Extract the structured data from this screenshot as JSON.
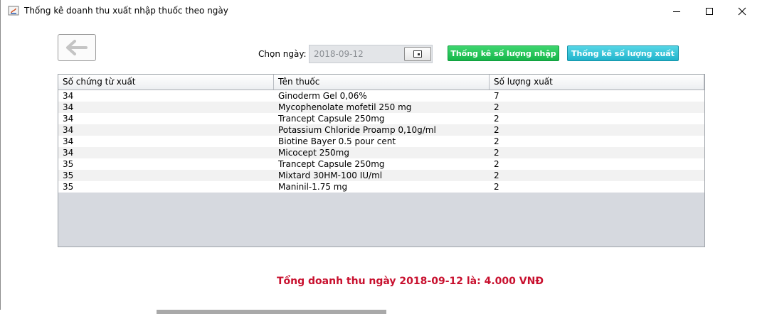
{
  "window": {
    "title": "Thống kê doanh thu xuất nhập thuốc theo ngày",
    "controls": [
      "minimize",
      "maximize",
      "close"
    ]
  },
  "toolbar": {
    "back_icon": "arrow-left-icon",
    "date_label": "Chọn ngày:",
    "date_value": "2018-09-12",
    "calendar_icon": "calendar-icon",
    "import_button": "Thống kê số lượng nhập",
    "export_button": "Thống kê số lượng xuất"
  },
  "table": {
    "columns": [
      "Số chứng từ xuất",
      "Tên thuốc",
      "Số lượng xuất"
    ],
    "rows": [
      [
        "34",
        "Ginoderm Gel 0,06%",
        "7"
      ],
      [
        "34",
        "Mycophenolate mofetil 250 mg",
        "2"
      ],
      [
        "34",
        "Trancept Capsule 250mg",
        "2"
      ],
      [
        "34",
        "Potassium Chloride Proamp 0,10g/ml",
        "2"
      ],
      [
        "34",
        "Biotine Bayer 0.5 pour cent",
        "2"
      ],
      [
        "34",
        "Micocept 250mg",
        "2"
      ],
      [
        "35",
        "Trancept Capsule 250mg",
        "2"
      ],
      [
        "35",
        "Mixtard 30HM-100 IU/ml",
        "2"
      ],
      [
        "35",
        "Maninil-1.75 mg",
        "2"
      ]
    ]
  },
  "summary": {
    "total_text": "Tổng doanh thu ngày 2018-09-12 là: 4.000 VNĐ"
  },
  "colors": {
    "import_button": "#16b64a",
    "export_button": "#21b4cc",
    "total_text": "#c8102e"
  }
}
